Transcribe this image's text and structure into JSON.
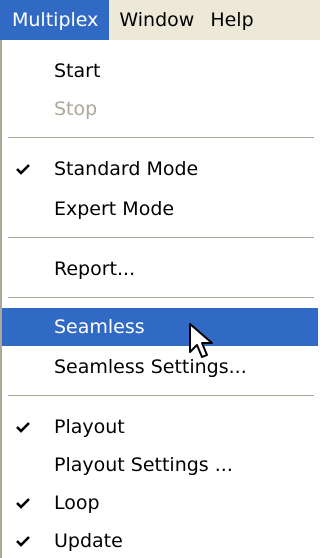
{
  "menubar": {
    "items": [
      {
        "label": "Multiplex"
      },
      {
        "label": "Window"
      },
      {
        "label": "Help"
      }
    ]
  },
  "menu": {
    "items": [
      {
        "label": "Start",
        "checked": false,
        "disabled": false
      },
      {
        "label": "Stop",
        "checked": false,
        "disabled": true
      },
      {
        "label": "Standard Mode",
        "checked": true,
        "disabled": false
      },
      {
        "label": "Expert Mode",
        "checked": false,
        "disabled": false
      },
      {
        "label": "Report...",
        "checked": false,
        "disabled": false
      },
      {
        "label": "Seamless",
        "checked": false,
        "disabled": false,
        "highlighted": true
      },
      {
        "label": "Seamless Settings...",
        "checked": false,
        "disabled": false
      },
      {
        "label": "Playout",
        "checked": true,
        "disabled": false
      },
      {
        "label": "Playout Settings ...",
        "checked": false,
        "disabled": false
      },
      {
        "label": "Loop",
        "checked": true,
        "disabled": false
      },
      {
        "label": "Update",
        "checked": true,
        "disabled": false
      }
    ]
  },
  "colors": {
    "highlight": "#316ac5",
    "menubar_bg": "#ece9d8",
    "disabled_text": "#aca899"
  },
  "icons": {
    "check": "check-icon",
    "cursor": "mouse-pointer-icon"
  }
}
